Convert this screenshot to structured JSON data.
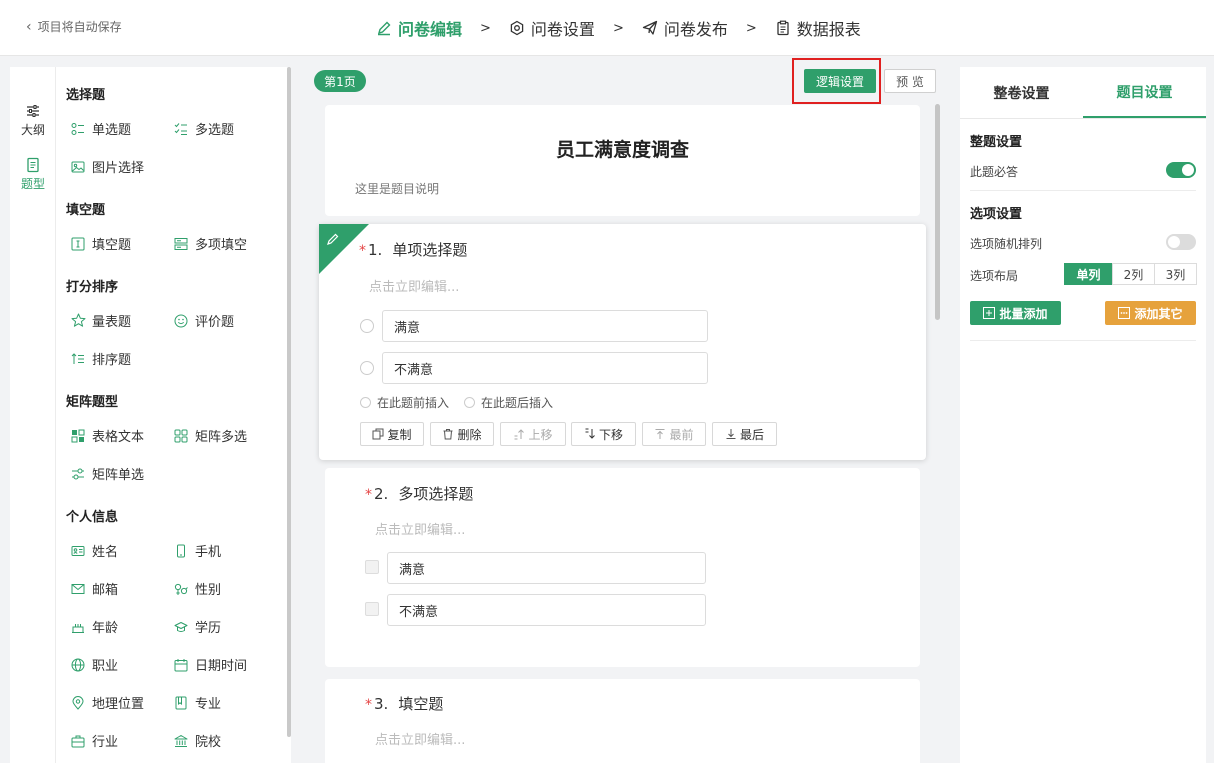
{
  "header": {
    "autosave_text": "项目将自动保存",
    "steps": [
      {
        "label": "问卷编辑",
        "icon": "pencil-icon",
        "active": true
      },
      {
        "label": "问卷设置",
        "icon": "gear-icon",
        "active": false
      },
      {
        "label": "问卷发布",
        "icon": "paper-plane-icon",
        "active": false
      },
      {
        "label": "数据报表",
        "icon": "clipboard-icon",
        "active": false
      }
    ],
    "separator": ">"
  },
  "left_tabs": [
    {
      "label": "大纲",
      "icon": "sliders-icon",
      "active": false
    },
    {
      "label": "题型",
      "icon": "document-icon",
      "active": true
    }
  ],
  "palette": {
    "choice": {
      "title": "选择题",
      "items": [
        "单选题",
        "多选题",
        "图片选择"
      ]
    },
    "fill": {
      "title": "填空题",
      "items": [
        "填空题",
        "多项填空"
      ]
    },
    "rating": {
      "title": "打分排序",
      "items": [
        "量表题",
        "评价题",
        "排序题"
      ]
    },
    "matrix": {
      "title": "矩阵题型",
      "items": [
        "表格文本",
        "矩阵多选",
        "矩阵单选"
      ]
    },
    "personal": {
      "title": "个人信息",
      "items": [
        "姓名",
        "手机",
        "邮箱",
        "性别",
        "年龄",
        "学历",
        "职业",
        "日期时间",
        "地理位置",
        "专业",
        "行业",
        "院校"
      ]
    }
  },
  "toolbar": {
    "page_badge": "第1页",
    "logic_button": "逻辑设置",
    "preview_button": "预 览"
  },
  "survey": {
    "title": "员工满意度调查",
    "description": "这里是题目说明",
    "questions": [
      {
        "star": "*",
        "num": "1.",
        "title": "单项选择题",
        "hint": "点击立即编辑...",
        "options": [
          "满意",
          "不满意"
        ]
      },
      {
        "star": "*",
        "num": "2.",
        "title": "多项选择题",
        "hint": "点击立即编辑...",
        "options": [
          "满意",
          "不满意"
        ]
      },
      {
        "star": "*",
        "num": "3.",
        "title": "填空题",
        "hint": "点击立即编辑..."
      }
    ],
    "insert_before": "在此题前插入",
    "insert_after": "在此题后插入",
    "actions": {
      "copy": "复制",
      "delete": "删除",
      "up": "上移",
      "down": "下移",
      "first": "最前",
      "last": "最后"
    }
  },
  "right_panel": {
    "tabs": [
      {
        "label": "整卷设置",
        "active": false
      },
      {
        "label": "题目设置",
        "active": true
      }
    ],
    "question_settings_title": "整题设置",
    "required_label": "此题必答",
    "required_on": true,
    "option_settings_title": "选项设置",
    "random_label": "选项随机排列",
    "random_on": false,
    "layout_label": "选项布局",
    "layout_options": [
      "单列",
      "2列",
      "3列"
    ],
    "layout_selected": "单列",
    "bulk_add": "批量添加",
    "add_other": "添加其它"
  },
  "colors": {
    "accent": "#2f9f6b",
    "orange": "#e6a23c",
    "required_star": "#e54545",
    "highlight_box": "#e02020"
  }
}
